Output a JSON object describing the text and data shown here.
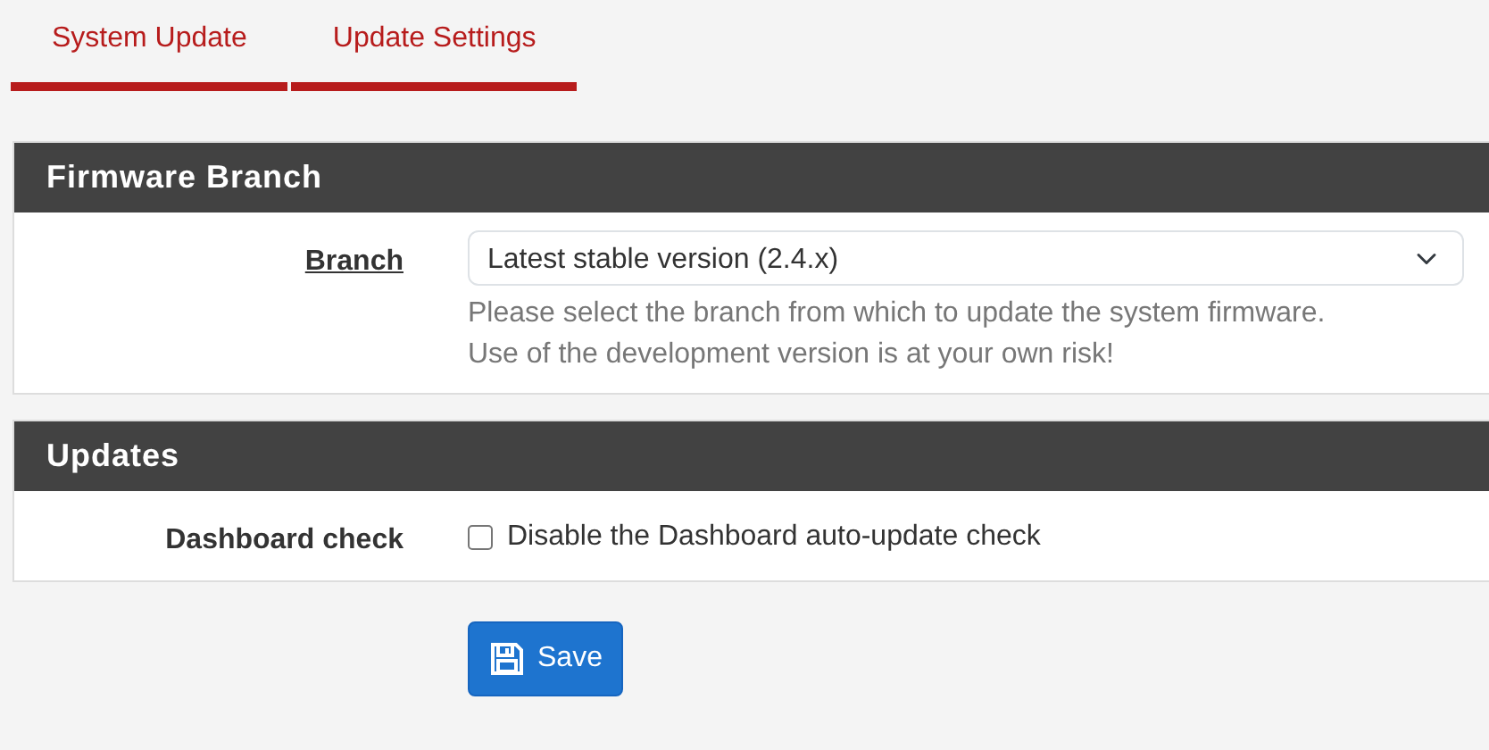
{
  "tabs": [
    {
      "label": "System Update",
      "selected": true
    },
    {
      "label": "Update Settings",
      "selected": true
    }
  ],
  "panels": [
    {
      "title": "Firmware Branch",
      "rows": [
        {
          "kind": "select",
          "label": "Branch",
          "underlined": true,
          "value": "Latest stable version (2.4.x)",
          "help": [
            "Please select the branch from which to update the system firmware.",
            "Use of the development version is at your own risk!"
          ]
        }
      ]
    },
    {
      "title": "Updates",
      "rows": [
        {
          "kind": "checkbox",
          "label": "Dashboard check",
          "underlined": false,
          "checked": false,
          "text": "Disable the Dashboard auto-update check"
        }
      ]
    }
  ],
  "save_button": {
    "label": "Save"
  }
}
